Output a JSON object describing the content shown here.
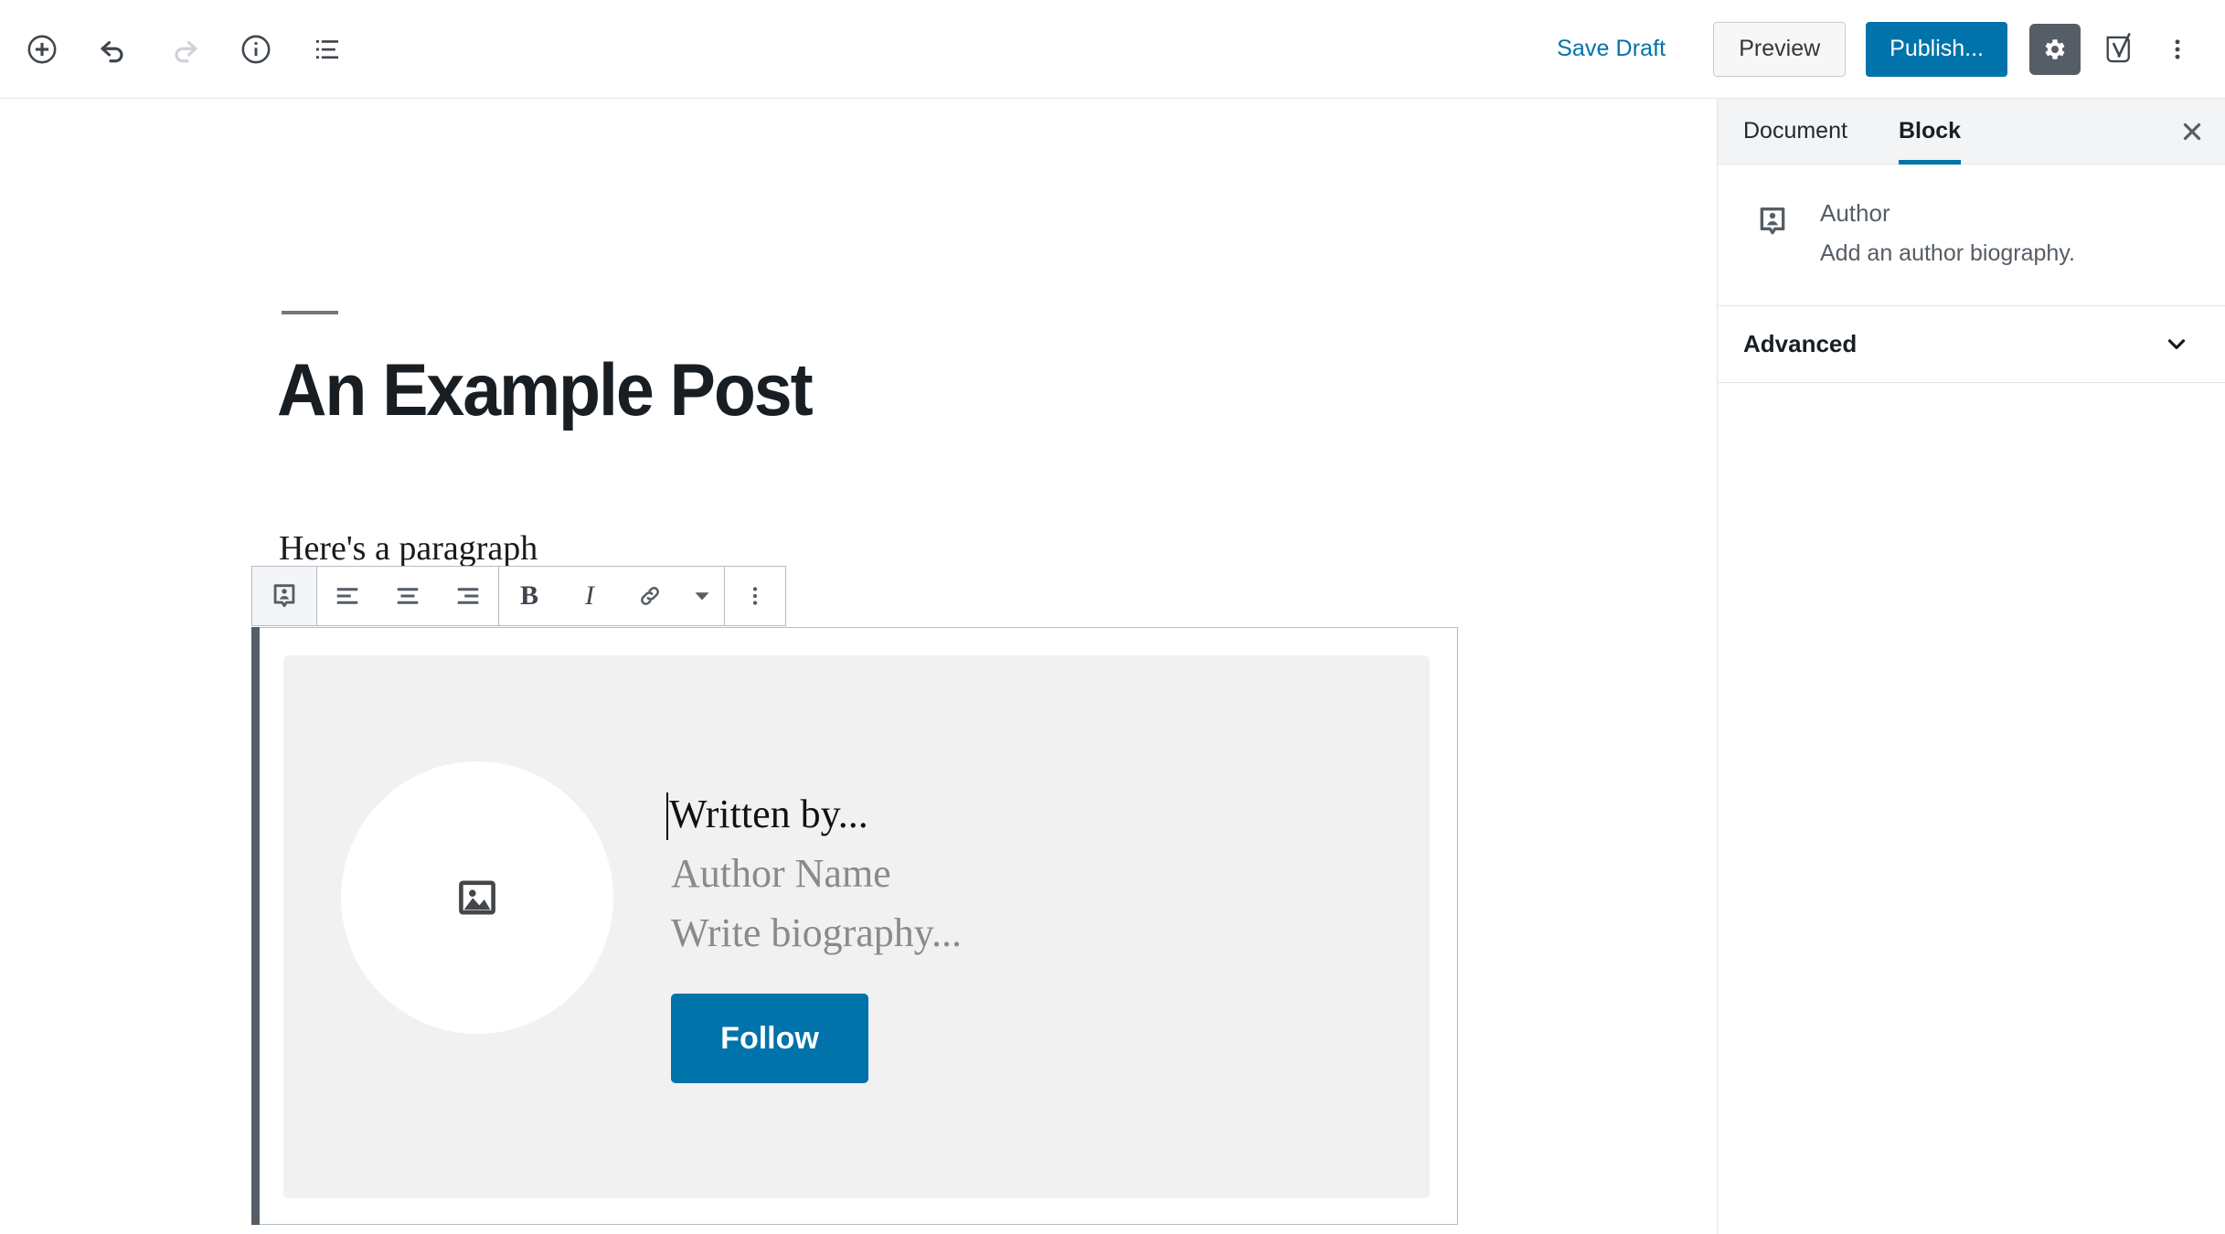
{
  "topbar": {
    "left_tools": [
      {
        "name": "add-block-icon",
        "label": "Add block"
      },
      {
        "name": "undo-icon",
        "label": "Undo"
      },
      {
        "name": "redo-icon",
        "label": "Redo"
      },
      {
        "name": "info-icon",
        "label": "Content structure"
      },
      {
        "name": "list-view-icon",
        "label": "Block navigation"
      }
    ],
    "save_draft_label": "Save Draft",
    "preview_label": "Preview",
    "publish_label": "Publish...",
    "settings_icon": "gear-icon",
    "yoast_icon": "yoast-seo-icon",
    "more_icon": "vertical-ellipsis-icon",
    "accent_color": "#0073aa",
    "gear_active_bg": "#555d66"
  },
  "sidebar": {
    "tabs": [
      {
        "label": "Document",
        "active": false
      },
      {
        "label": "Block",
        "active": true
      }
    ],
    "close_icon": "close-icon",
    "block_card": {
      "icon": "author-block-icon",
      "title": "Author",
      "description": "Add an author biography."
    },
    "panels": [
      {
        "label": "Advanced",
        "chevron": "chevron-down-icon",
        "expanded": false
      }
    ]
  },
  "editor": {
    "post_title": "An Example Post",
    "paragraph": "Here's a paragraph",
    "block_toolbar": {
      "block_type_icon": "author-block-icon",
      "items": [
        {
          "name": "align-left-icon",
          "label": "Align left"
        },
        {
          "name": "align-center-icon",
          "label": "Align center"
        },
        {
          "name": "align-right-icon",
          "label": "Align right"
        },
        {
          "name": "bold-button",
          "label": "B"
        },
        {
          "name": "italic-button",
          "label": "I"
        },
        {
          "name": "link-icon",
          "label": "Link"
        },
        {
          "name": "chevron-down-icon",
          "label": "More rich text controls"
        },
        {
          "name": "vertical-ellipsis-icon",
          "label": "More options"
        }
      ]
    },
    "author_block": {
      "avatar_icon": "image-placeholder-icon",
      "written_by": "Written by...",
      "author_name_placeholder": "Author Name",
      "biography_placeholder": "Write biography...",
      "follow_label": "Follow",
      "follow_color": "#0073aa",
      "panel_bg": "#f1f1f1"
    }
  }
}
